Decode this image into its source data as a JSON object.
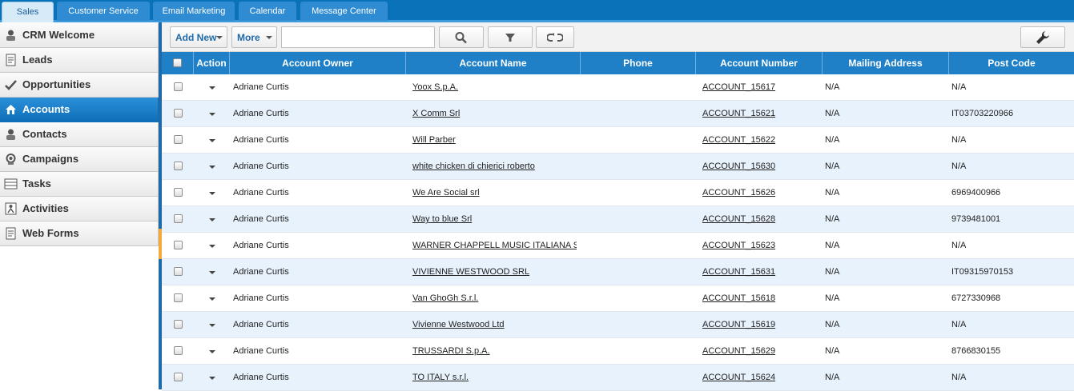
{
  "tabs": [
    {
      "label": "Sales",
      "active": true
    },
    {
      "label": "Customer Service",
      "active": false
    },
    {
      "label": "Email Marketing",
      "active": false
    },
    {
      "label": "Calendar",
      "active": false
    },
    {
      "label": "Message Center",
      "active": false
    }
  ],
  "sidebar": {
    "items": [
      {
        "label": "CRM Welcome",
        "icon": "crm-welcome-icon",
        "active": false
      },
      {
        "label": "Leads",
        "icon": "leads-icon",
        "active": false
      },
      {
        "label": "Opportunities",
        "icon": "opportunities-icon",
        "active": false
      },
      {
        "label": "Accounts",
        "icon": "accounts-icon",
        "active": true
      },
      {
        "label": "Contacts",
        "icon": "contacts-icon",
        "active": false
      },
      {
        "label": "Campaigns",
        "icon": "campaigns-icon",
        "active": false
      },
      {
        "label": "Tasks",
        "icon": "tasks-icon",
        "active": false
      },
      {
        "label": "Activities",
        "icon": "activities-icon",
        "active": false
      },
      {
        "label": "Web Forms",
        "icon": "web-forms-icon",
        "active": false
      }
    ]
  },
  "toolbar": {
    "add_new_label": "Add New",
    "more_label": "More",
    "search_value": "",
    "search_placeholder": "",
    "icons": [
      "search-icon",
      "filter-icon",
      "refresh-icon",
      "wrench-icon"
    ]
  },
  "table": {
    "columns": [
      "",
      "Action",
      "Account Owner",
      "Account Name",
      "Phone",
      "Account Number",
      "Mailing Address",
      "Post Code"
    ],
    "rows": [
      {
        "owner": "Adriane Curtis",
        "name": "Yoox S.p.A.",
        "phone": "",
        "number": "ACCOUNT_15617",
        "address": "N/A",
        "post": "N/A"
      },
      {
        "owner": "Adriane Curtis",
        "name": "X Comm Srl",
        "phone": "",
        "number": "ACCOUNT_15621",
        "address": "N/A",
        "post": "IT03703220966"
      },
      {
        "owner": "Adriane Curtis",
        "name": "Will Parber",
        "phone": "",
        "number": "ACCOUNT_15622",
        "address": "N/A",
        "post": "N/A"
      },
      {
        "owner": "Adriane Curtis",
        "name": "white chicken di chierici roberto",
        "phone": "",
        "number": "ACCOUNT_15630",
        "address": "N/A",
        "post": "N/A"
      },
      {
        "owner": "Adriane Curtis",
        "name": "We Are Social srl",
        "phone": "",
        "number": "ACCOUNT_15626",
        "address": "N/A",
        "post": "6969400966"
      },
      {
        "owner": "Adriane Curtis",
        "name": "Way to blue Srl",
        "phone": "",
        "number": "ACCOUNT_15628",
        "address": "N/A",
        "post": "9739481001"
      },
      {
        "owner": "Adriane Curtis",
        "name": "WARNER CHAPPELL MUSIC ITALIANA S.R.",
        "phone": "",
        "number": "ACCOUNT_15623",
        "address": "N/A",
        "post": "N/A"
      },
      {
        "owner": "Adriane Curtis",
        "name": "VIVIENNE WESTWOOD SRL",
        "phone": "",
        "number": "ACCOUNT_15631",
        "address": "N/A",
        "post": "IT09315970153"
      },
      {
        "owner": "Adriane Curtis",
        "name": "Van GhoGh S.r.l.",
        "phone": "",
        "number": "ACCOUNT_15618",
        "address": "N/A",
        "post": "6727330968"
      },
      {
        "owner": "Adriane Curtis",
        "name": "Vivienne Westwood Ltd",
        "phone": "",
        "number": "ACCOUNT_15619",
        "address": "N/A",
        "post": "N/A"
      },
      {
        "owner": "Adriane Curtis",
        "name": "TRUSSARDI S.p.A.",
        "phone": "",
        "number": "ACCOUNT_15629",
        "address": "N/A",
        "post": "8766830155"
      },
      {
        "owner": "Adriane Curtis",
        "name": "TO ITALY s.r.l.",
        "phone": "",
        "number": "ACCOUNT_15624",
        "address": "N/A",
        "post": "N/A"
      }
    ]
  },
  "colors": {
    "brand_blue": "#0a72b9",
    "header_blue": "#1f80c8",
    "row_alt": "#e8f2fc",
    "active_side": "#1a7fcb"
  }
}
